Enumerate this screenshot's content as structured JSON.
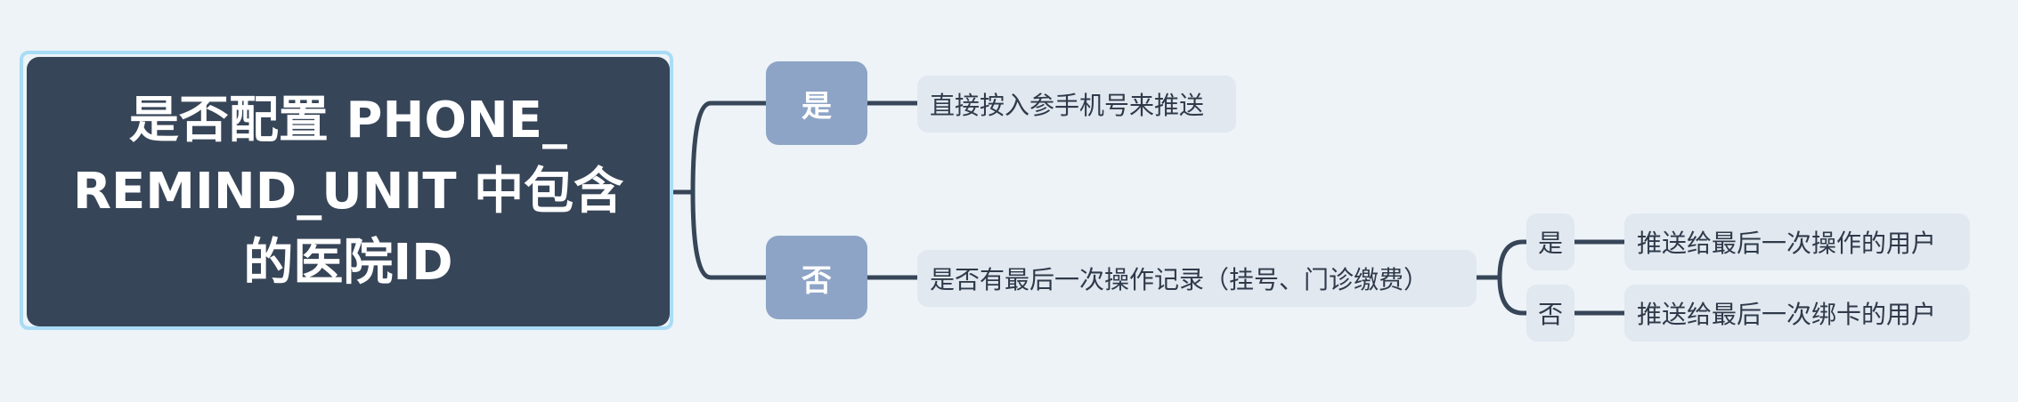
{
  "root": {
    "title": "是否配置 PHONE_ REMIND_UNIT 中包含 的医院ID"
  },
  "branches": {
    "yes": {
      "label": "是",
      "leaf": "直接按入参手机号来推送"
    },
    "no": {
      "label": "否",
      "leaf": "是否有最后一次操作记录（挂号、门诊缴费）",
      "sub": {
        "yes": {
          "label": "是",
          "leaf": "推送给最后一次操作的用户"
        },
        "no": {
          "label": "否",
          "leaf": "推送给最后一次绑卡的用户"
        }
      }
    }
  },
  "colors": {
    "background": "#edf3f7",
    "root_fill": "#374558",
    "root_outline": "#a9dcf5",
    "branch_fill": "#8da4c6",
    "leaf_fill": "#e1e8f0",
    "connector": "#374558"
  }
}
